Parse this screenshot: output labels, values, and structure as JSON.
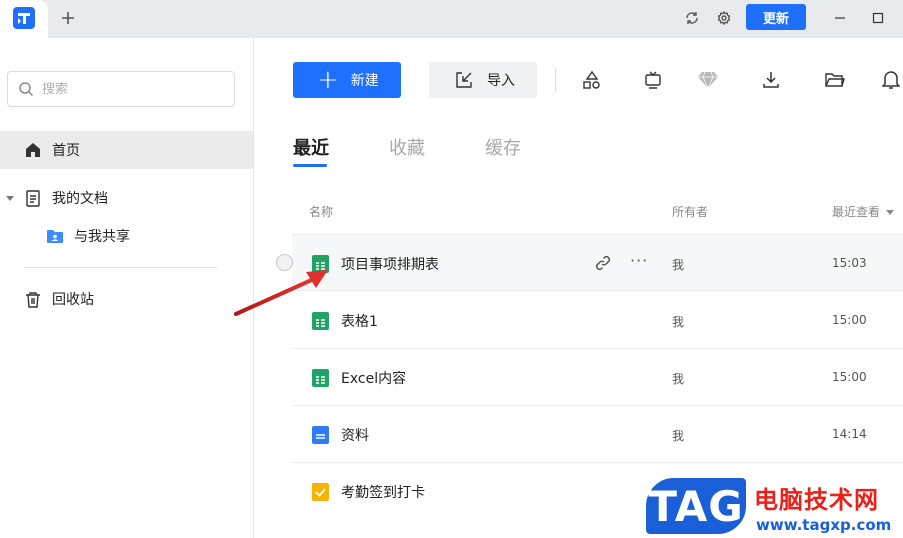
{
  "titlebar": {
    "update_label": "更新",
    "icons": [
      "app-logo-icon",
      "add-tab-icon",
      "sync-icon",
      "settings-icon",
      "minimize-icon",
      "maximize-icon"
    ]
  },
  "sidebar": {
    "search_placeholder": "搜索",
    "items": [
      {
        "label": "首页",
        "icon": "home-icon",
        "active": true
      },
      {
        "label": "我的文档",
        "icon": "document-icon"
      },
      {
        "label": "与我共享",
        "icon": "shared-folder-icon"
      },
      {
        "label": "回收站",
        "icon": "trash-icon"
      }
    ]
  },
  "toolbar": {
    "new_label": "新建",
    "import_label": "导入",
    "icons": [
      "shapes-icon",
      "tv-icon",
      "diamond-icon",
      "download-icon",
      "folder-icon",
      "bell-icon"
    ]
  },
  "tabs": [
    {
      "label": "最近",
      "active": true
    },
    {
      "label": "收藏"
    },
    {
      "label": "缓存"
    }
  ],
  "table": {
    "columns": {
      "name": "名称",
      "owner": "所有者",
      "viewed": "最近查看"
    },
    "rows": [
      {
        "name": "项目事项排期表",
        "owner": "我",
        "time": "15:03",
        "type": "sheet"
      },
      {
        "name": "表格1",
        "owner": "我",
        "time": "15:00",
        "type": "sheet"
      },
      {
        "name": "Excel内容",
        "owner": "我",
        "time": "15:00",
        "type": "sheet"
      },
      {
        "name": "资料",
        "owner": "我",
        "time": "14:14",
        "type": "doc"
      },
      {
        "name": "考勤签到打卡",
        "owner": "",
        "time": "",
        "type": "form"
      }
    ],
    "row_actions": [
      "link-icon",
      "more-icon"
    ],
    "more_glyph": "···"
  },
  "colors": {
    "accent": "#1e6ffb",
    "sheet_green": "#21a366",
    "doc_blue": "#2f7cf6",
    "form_yellow": "#f5b400",
    "annotation_arrow": "#d8262c"
  },
  "watermark": {
    "badge": "TAG",
    "title": "电脑技术网",
    "url": "www.tagxp.com"
  }
}
